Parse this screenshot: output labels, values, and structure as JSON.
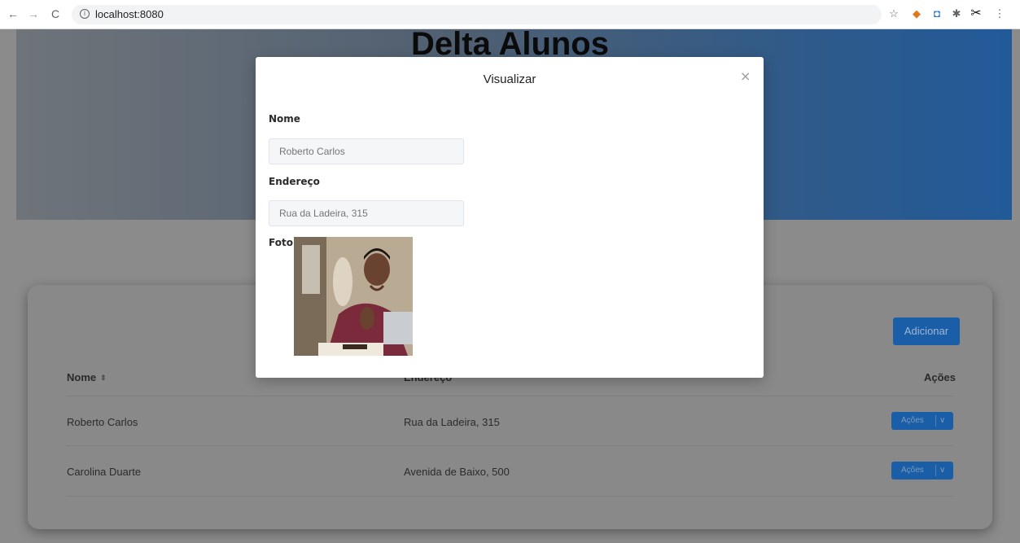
{
  "browser": {
    "url": "localhost:8080",
    "nav": {
      "back": "←",
      "forward": "→",
      "reload": "C"
    }
  },
  "page": {
    "title": "Delta Alunos",
    "add_button": "Adicionar",
    "table": {
      "headers": {
        "name": "Nome",
        "address": "Endereço",
        "actions": "Ações"
      },
      "rows": [
        {
          "name": "Roberto Carlos",
          "address": "Rua da Ladeira, 315",
          "action": "Ações"
        },
        {
          "name": "Carolina Duarte",
          "address": "Avenida de Baixo, 500",
          "action": "Ações"
        }
      ]
    }
  },
  "modal": {
    "title": "Visualizar",
    "close": "×",
    "name_label": "Nome",
    "name_value": "Roberto Carlos",
    "address_label": "Endereço",
    "address_value": "Rua da Ladeira, 315",
    "photo_label": "Foto:"
  },
  "colors": {
    "accent": "#1a5ea8",
    "overlay": "#8b8b8b"
  }
}
